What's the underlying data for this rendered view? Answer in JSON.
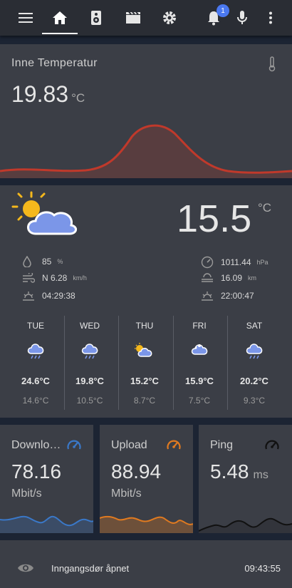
{
  "toolbar": {
    "icons": [
      "menu-icon",
      "home-icon",
      "speaker-icon",
      "clapperboard-icon",
      "gear-icon",
      "bell-icon",
      "microphone-icon",
      "more-vert-icon"
    ],
    "notification_count": "1",
    "active_tab": "home"
  },
  "indoor": {
    "title": "Inne Temperatur",
    "value": "19.83",
    "unit": "°C",
    "line_color": "#c0392b"
  },
  "weather": {
    "temperature": "15.5",
    "unit": "°C",
    "humidity": "85",
    "humidity_unit": "%",
    "wind": "N 6.28",
    "wind_unit": "km/h",
    "sunrise": "04:29:38",
    "pressure": "1011.44",
    "pressure_unit": "hPa",
    "visibility": "16.09",
    "visibility_unit": "km",
    "sunset": "22:00:47",
    "forecast": [
      {
        "day": "TUE",
        "icon": "rain-icon",
        "high": "24.6°C",
        "low": "14.6°C"
      },
      {
        "day": "WED",
        "icon": "rain-icon",
        "high": "19.8°C",
        "low": "10.5°C"
      },
      {
        "day": "THU",
        "icon": "partly-cloudy-icon",
        "high": "15.2°C",
        "low": "8.7°C"
      },
      {
        "day": "FRI",
        "icon": "snow-icon",
        "high": "15.9°C",
        "low": "7.5°C"
      },
      {
        "day": "SAT",
        "icon": "rain-icon",
        "high": "20.2°C",
        "low": "9.3°C"
      }
    ]
  },
  "network": {
    "download": {
      "title": "Downlo…",
      "value": "78.16",
      "unit": "Mbit/s",
      "color": "#3a78c8"
    },
    "upload": {
      "title": "Upload",
      "value": "88.94",
      "unit": "Mbit/s",
      "color": "#e07a20"
    },
    "ping": {
      "title": "Ping",
      "value": "5.48",
      "unit": "ms",
      "color": "#111111"
    }
  },
  "status": {
    "icon": "eye-icon",
    "text": "Inngangsdør åpnet",
    "time": "09:43:55"
  },
  "colors": {
    "background": "#1c2433",
    "card": "#3b3e46",
    "toolbar": "#2a2d34",
    "accent_blue": "#4a78f0"
  }
}
